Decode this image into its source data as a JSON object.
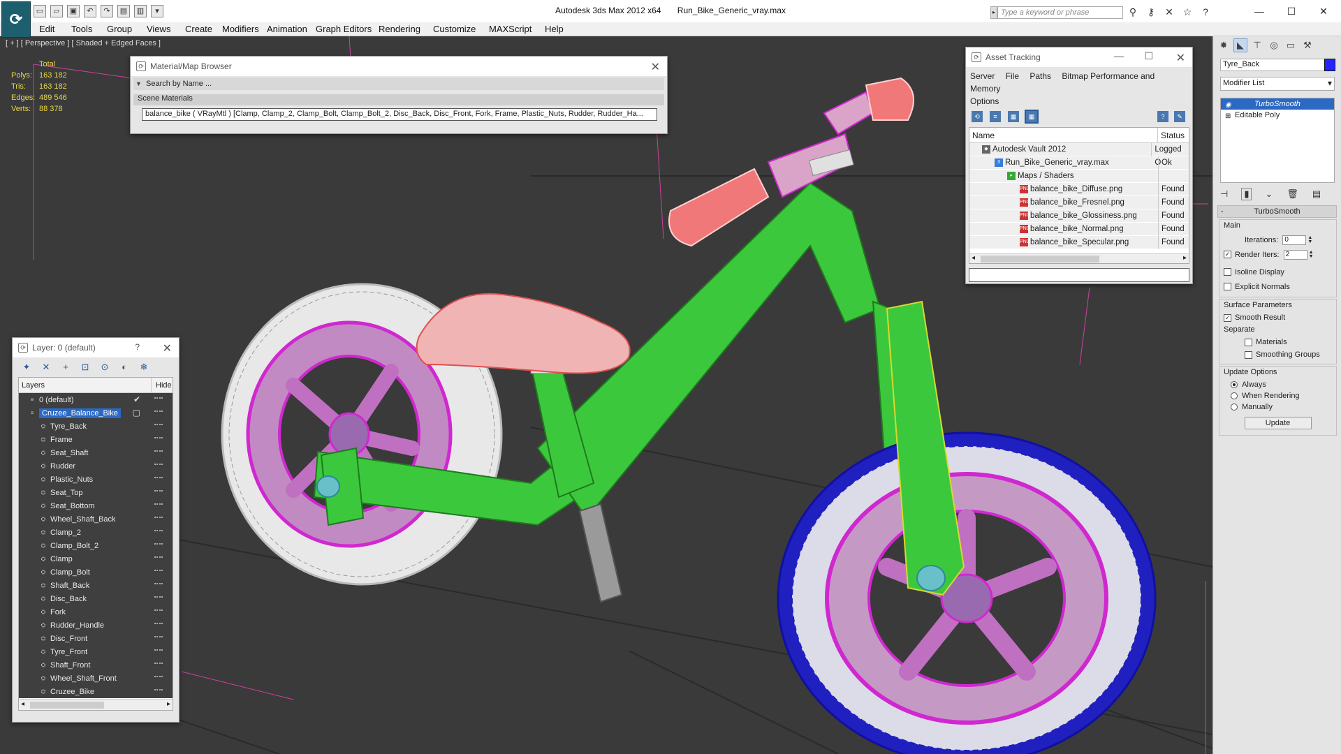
{
  "window": {
    "app_title": "Autodesk 3ds Max  2012 x64",
    "file_name": "Run_Bike_Generic_vray.max",
    "search_placeholder": "Type a keyword or phrase",
    "minimize": "—",
    "maximize": "☐",
    "close": "✕"
  },
  "menu": [
    "Edit",
    "Tools",
    "Group",
    "Views",
    "Create",
    "Modifiers",
    "Animation",
    "Graph Editors",
    "Rendering",
    "Customize",
    "MAXScript",
    "Help"
  ],
  "viewport": {
    "label": "[ + ] [ Perspective ] [ Shaded + Edged Faces ]",
    "stats": {
      "total_label": "Total",
      "rows": [
        {
          "k": "Polys:",
          "v": "163 182"
        },
        {
          "k": "Tris:",
          "v": "163 182"
        },
        {
          "k": "Edges:",
          "v": "489 546"
        },
        {
          "k": "Verts:",
          "v": "88 378"
        }
      ]
    }
  },
  "material_browser": {
    "title": "Material/Map Browser",
    "search_label": "Search by Name ...",
    "section": "Scene Materials",
    "material": "balance_bike  ( VRayMtl )  [Clamp, Clamp_2, Clamp_Bolt, Clamp_Bolt_2, Disc_Back, Disc_Front, Fork, Frame, Plastic_Nuts, Rudder, Rudder_Ha..."
  },
  "asset_tracking": {
    "title": "Asset Tracking",
    "menu": [
      "Server",
      "File",
      "Paths",
      "Bitmap Performance and Memory"
    ],
    "menu2": "Options",
    "col_name": "Name",
    "col_status": "Status",
    "rows": [
      {
        "name": "Autodesk Vault 2012",
        "status": "Logged O",
        "indent": 18,
        "icon": "vault"
      },
      {
        "name": "Run_Bike_Generic_vray.max",
        "status": "Ok",
        "indent": 36,
        "icon": "file"
      },
      {
        "name": "Maps / Shaders",
        "status": "",
        "indent": 54,
        "icon": "folder"
      },
      {
        "name": "balance_bike_Diffuse.png",
        "status": "Found",
        "indent": 72,
        "icon": "png"
      },
      {
        "name": "balance_bike_Fresnel.png",
        "status": "Found",
        "indent": 72,
        "icon": "png"
      },
      {
        "name": "balance_bike_Glossiness.png",
        "status": "Found",
        "indent": 72,
        "icon": "png"
      },
      {
        "name": "balance_bike_Normal.png",
        "status": "Found",
        "indent": 72,
        "icon": "png"
      },
      {
        "name": "balance_bike_Specular.png",
        "status": "Found",
        "indent": 72,
        "icon": "png"
      }
    ]
  },
  "layers": {
    "title": "Layer: 0 (default)",
    "help": "?",
    "col_layers": "Layers",
    "col_hide": "Hide",
    "rows": [
      {
        "name": "0 (default)",
        "level": 1,
        "type": "layer",
        "check": "✔"
      },
      {
        "name": "Cruzee_Balance_Bike",
        "level": 1,
        "type": "layer",
        "selected": true,
        "check": "▢"
      },
      {
        "name": "Tyre_Back",
        "level": 2
      },
      {
        "name": "Frame",
        "level": 2
      },
      {
        "name": "Seat_Shaft",
        "level": 2
      },
      {
        "name": "Rudder",
        "level": 2
      },
      {
        "name": "Plastic_Nuts",
        "level": 2
      },
      {
        "name": "Seat_Top",
        "level": 2
      },
      {
        "name": "Seat_Bottom",
        "level": 2
      },
      {
        "name": "Wheel_Shaft_Back",
        "level": 2
      },
      {
        "name": "Clamp_2",
        "level": 2
      },
      {
        "name": "Clamp_Bolt_2",
        "level": 2
      },
      {
        "name": "Clamp",
        "level": 2
      },
      {
        "name": "Clamp_Bolt",
        "level": 2
      },
      {
        "name": "Shaft_Back",
        "level": 2
      },
      {
        "name": "Disc_Back",
        "level": 2
      },
      {
        "name": "Fork",
        "level": 2
      },
      {
        "name": "Rudder_Handle",
        "level": 2
      },
      {
        "name": "Disc_Front",
        "level": 2
      },
      {
        "name": "Tyre_Front",
        "level": 2
      },
      {
        "name": "Shaft_Front",
        "level": 2
      },
      {
        "name": "Wheel_Shaft_Front",
        "level": 2
      },
      {
        "name": "Cruzee_Bike",
        "level": 2
      }
    ]
  },
  "command_panel": {
    "object_name": "Tyre_Back",
    "object_color": "#2424ff",
    "modifier_list": "Modifier List",
    "stack": [
      {
        "name": "TurboSmooth",
        "selected": true
      },
      {
        "name": "Editable Poly",
        "selected": false
      }
    ],
    "turbosmooth_title": "TurboSmooth",
    "main_title": "Main",
    "iterations_label": "Iterations:",
    "iterations_value": "0",
    "render_iters_label": "Render Iters:",
    "render_iters_value": "2",
    "isoline_label": "Isoline Display",
    "explicit_label": "Explicit Normals",
    "surface_title": "Surface Parameters",
    "smooth_result_label": "Smooth Result",
    "separate_label": "Separate",
    "materials_label": "Materials",
    "smoothing_groups_label": "Smoothing Groups",
    "update_title": "Update Options",
    "always_label": "Always",
    "when_rendering_label": "When Rendering",
    "manually_label": "Manually",
    "update_button": "Update"
  },
  "colors": {
    "frame": "#3cc83c",
    "tyre_back": "#ffffff",
    "tyre_front": "#2020c0",
    "disc": "#d028d0",
    "seat": "#f0b4b4",
    "handle": "#f07878"
  }
}
